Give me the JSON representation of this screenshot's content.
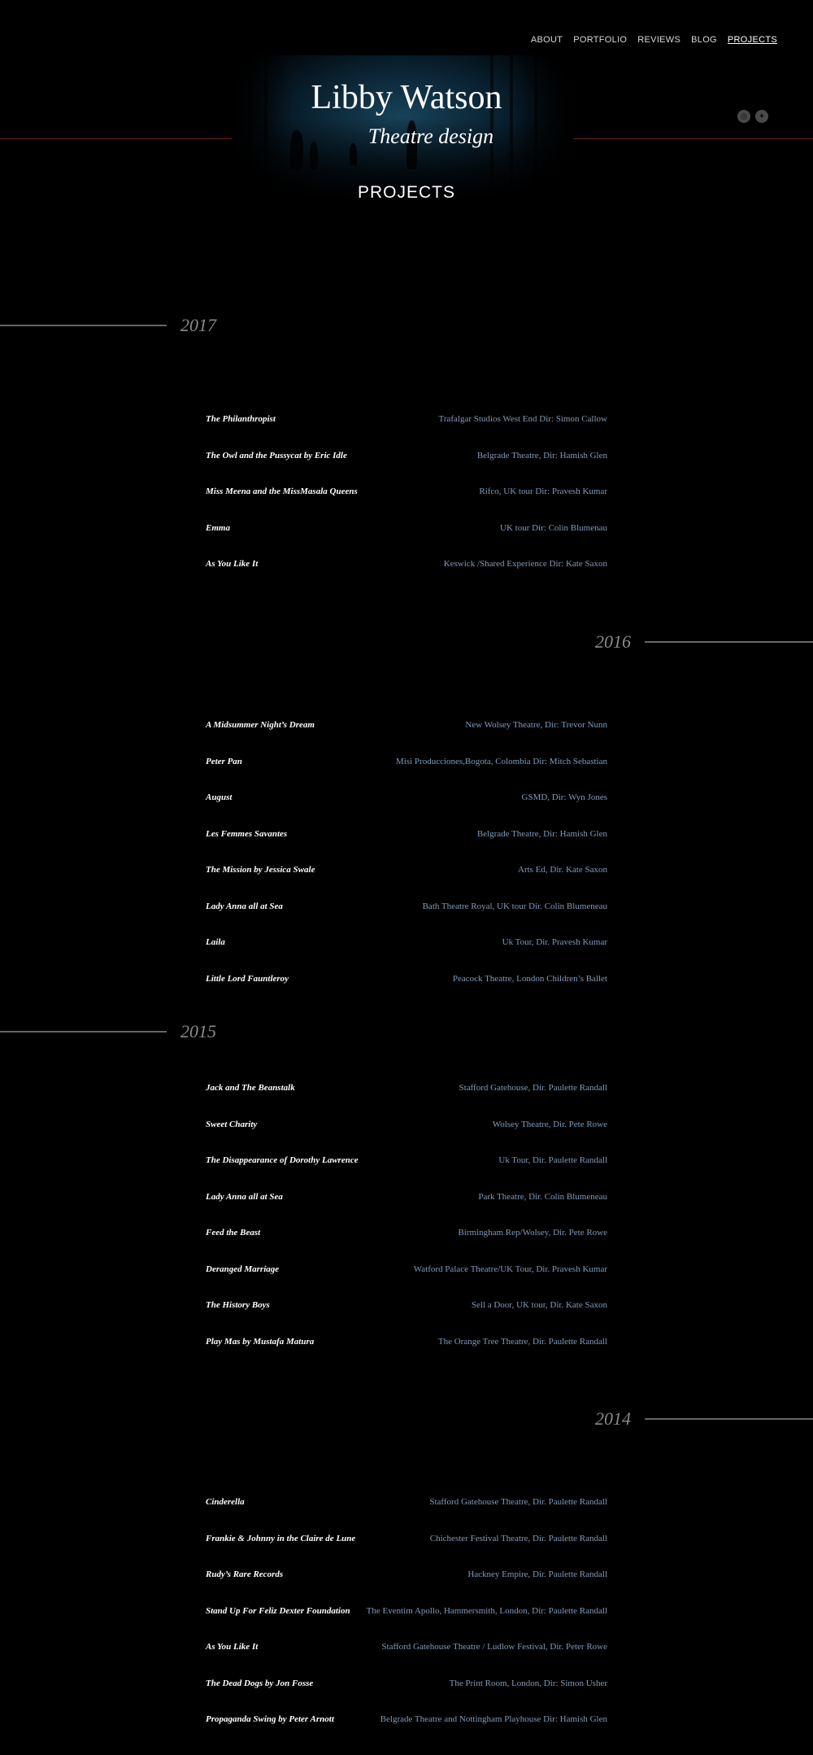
{
  "nav": [
    "ABOUT",
    "PORTFOLIO",
    "REVIEWS",
    "BLOG",
    "PROJECTS"
  ],
  "nav_active": "PROJECTS",
  "header": {
    "title": "Libby Watson",
    "subtitle": "Theatre design",
    "page_heading": "PROJECTS"
  },
  "social": [
    "instagram-icon",
    "twitter-icon"
  ],
  "colors": {
    "background": "#000000",
    "venue": "#7f9bb8",
    "year": "#8a8a8a",
    "accent_line": "#6a1c1c"
  },
  "years": [
    {
      "year": "2017",
      "projects": [
        {
          "title": "The Philanthropist",
          "venue": "Trafalgar Studios West End Dir: Simon Callow"
        },
        {
          "title": "The Owl and the Pussycat by Eric Idle",
          "venue": "Belgrade Theatre, Dir: Hamish Glen"
        },
        {
          "title": "Miss Meena and the MissMasala Queens",
          "venue": "Rifco, UK tour Dir:  Pravesh Kumar"
        },
        {
          "title": "Emma",
          "venue": "UK tour Dir: Colin Blumenau"
        },
        {
          "title": "As You Like It",
          "venue": "Keswick /Shared Experience Dir: Kate Saxon"
        }
      ]
    },
    {
      "year": "2016",
      "projects": [
        {
          "title": "A Midsummer Night’s Dream",
          "venue": "New Wolsey Theatre, Dir: Trevor Nunn"
        },
        {
          "title": "Peter Pan",
          "venue": "Misi Producciones,Bogota, Colombia Dir:  Mitch Sebastian"
        },
        {
          "title": "August",
          "venue": "GSMD, Dir:  Wyn Jones"
        },
        {
          "title": "Les Femmes Savantes",
          "venue": "Belgrade Theatre, Dir: Hamish Glen"
        },
        {
          "title": "The Mission by Jessica Swale",
          "venue": "Arts Ed, Dir. Kate Saxon"
        },
        {
          "title": "Lady Anna all at Sea",
          "venue": "Bath Theatre Royal, UK tour Dir. Colin Blumeneau"
        },
        {
          "title": "Laila",
          "venue": "Uk Tour, Dir. Pravesh Kumar"
        },
        {
          "title": "Little Lord Fauntleroy",
          "venue": "Peacock Theatre, London Children’s Ballet"
        }
      ]
    },
    {
      "year": "2015",
      "projects": [
        {
          "title": "Jack and The Beanstalk",
          "venue": "Stafford Gatehouse, Dir. Paulette Randall"
        },
        {
          "title": "Sweet Charity",
          "venue": "Wolsey Theatre, Dir. Pete Rowe"
        },
        {
          "title": "The Disappearance of Dorothy Lawrence",
          "venue": "Uk Tour, Dir. Paulette Randall"
        },
        {
          "title": "Lady Anna all at Sea",
          "venue": "Park Theatre, Dir. Colin Blumeneau"
        },
        {
          "title": "Feed the Beast",
          "venue": "Birmingham Rep/Wolsey, Dir. Pete Rowe"
        },
        {
          "title": "Deranged Marriage",
          "venue": "Watford Palace Theatre/UK Tour, Dir. Pravesh Kumar"
        },
        {
          "title": "The History Boys",
          "venue": "Sell a Door, UK tour, Dir. Kate Saxon"
        },
        {
          "title": "Play Mas by Mustafa Matura",
          "venue": "The Orange Tree Theatre, Dir. Paulette Randall"
        }
      ]
    },
    {
      "year": "2014",
      "projects": [
        {
          "title": "Cinderella",
          "venue": "Stafford Gatehouse Theatre, Dir. Paulette Randall"
        },
        {
          "title": "Frankie & Johnny in the Claire de Lune",
          "venue": "Chichester Festival Theatre, Dir. Paulette Randall"
        },
        {
          "title": "Rudy’s Rare Records",
          "venue": "Hackney Empire, Dir. Paulette Randall"
        },
        {
          "title": "Stand Up For Feliz Dexter Foundation",
          "venue": "The Eventim Apollo, Hammersmith, London, Dir: Paulette Randall"
        },
        {
          "title": "As You Like It",
          "venue": "Stafford Gatehouse Theatre / Ludlow Festival, Dir. Peter Rowe"
        },
        {
          "title": "The Dead Dogs by Jon Fosse",
          "venue": "The Print Room, London, Dir: Simon Usher"
        },
        {
          "title": "Propaganda Swing by Peter Arnott",
          "venue": "Belgrade Theatre and Nottingham Playhouse Dir: Hamish Glen"
        }
      ]
    }
  ]
}
